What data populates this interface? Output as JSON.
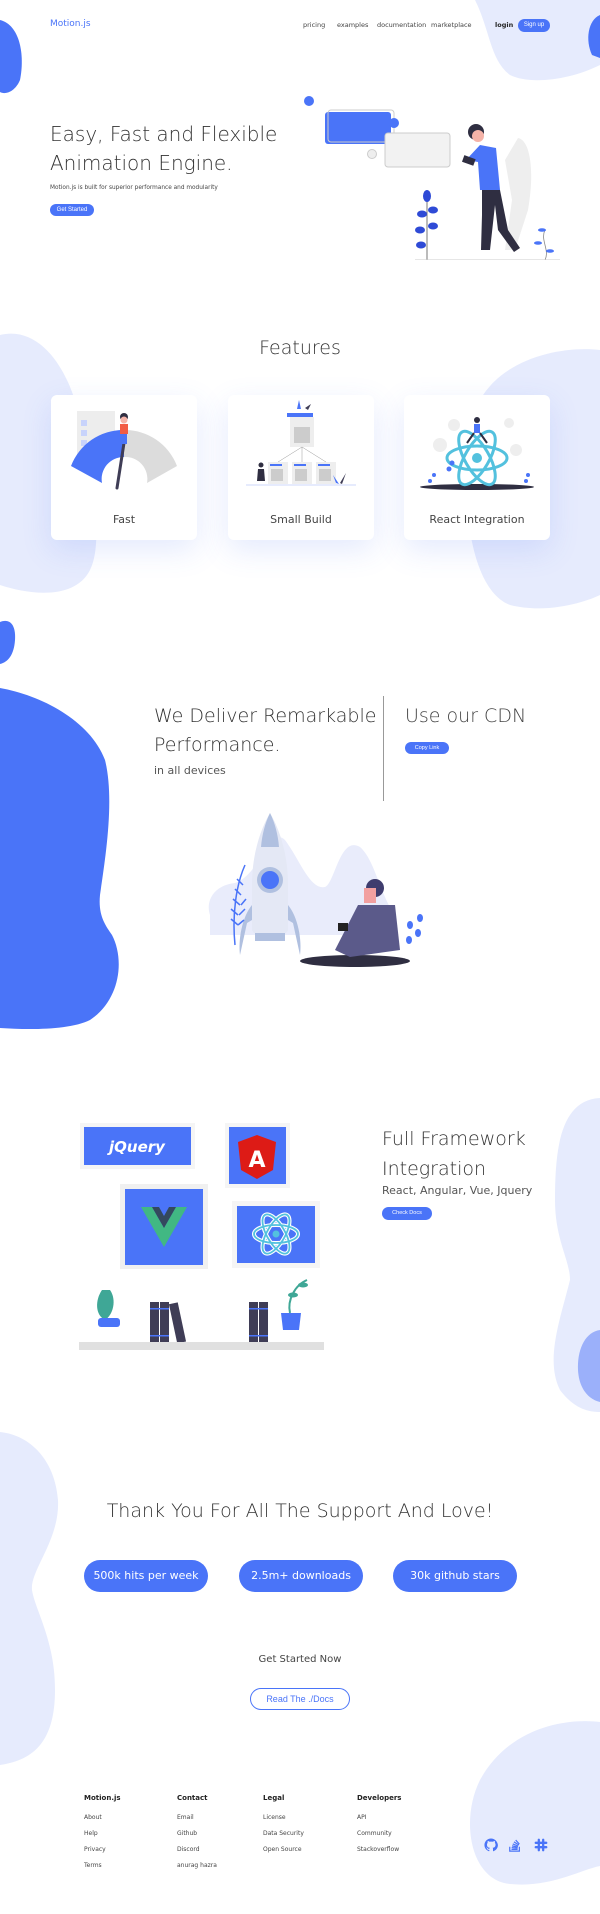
{
  "nav": {
    "logo": "Motion.js",
    "links": [
      "pricing",
      "examples",
      "documentation",
      "marketplace"
    ],
    "login": "login",
    "signup": "Sign up"
  },
  "hero": {
    "title_line1": "Easy, Fast and Flexible",
    "title_line2": "Animation Engine.",
    "subtitle": "Motion.js is built for superior performance and modularity",
    "cta": "Get Started"
  },
  "features": {
    "title": "Features",
    "cards": [
      {
        "label": "Fast",
        "illustration": "speedometer-illustration"
      },
      {
        "label": "Small Build",
        "illustration": "build-tree-illustration"
      },
      {
        "label": "React Integration",
        "illustration": "react-atom-illustration"
      }
    ]
  },
  "performance": {
    "title_line1": "We Deliver Remarkable",
    "title_line2": "Performance.",
    "subtitle": "in all devices",
    "cdn_title": "Use our CDN",
    "copy_button": "Copy Link"
  },
  "frameworks": {
    "title_line1": "Full Framework",
    "title_line2": "Integration",
    "subtitle": "React, Angular, Vue, Jquery",
    "button": "Check Docs",
    "logos": [
      "jQuery",
      "A",
      "Vue",
      "React"
    ]
  },
  "support": {
    "title": "Thank You For All The Support And Love!",
    "stats": [
      "500k hits per week",
      "2.5m+ downloads",
      "30k github stars"
    ],
    "get_started": "Get Started Now",
    "docs_button": "Read The ./Docs"
  },
  "footer": {
    "columns": [
      {
        "heading": "Motion.js",
        "links": [
          "About",
          "Help",
          "Privacy",
          "Terms"
        ]
      },
      {
        "heading": "Contact",
        "links": [
          "Email",
          "Github",
          "Discord",
          "anurag hazra"
        ]
      },
      {
        "heading": "Legal",
        "links": [
          "License",
          "Data Security",
          "Open Source"
        ]
      },
      {
        "heading": "Developers",
        "links": [
          "API",
          "Community",
          "Stackoverflow"
        ]
      }
    ],
    "social": [
      "github-icon",
      "stackoverflow-icon",
      "slack-icon"
    ]
  },
  "colors": {
    "primary": "#4a74f8",
    "blob_light": "#e6ebfd",
    "text_dark": "#333333"
  }
}
